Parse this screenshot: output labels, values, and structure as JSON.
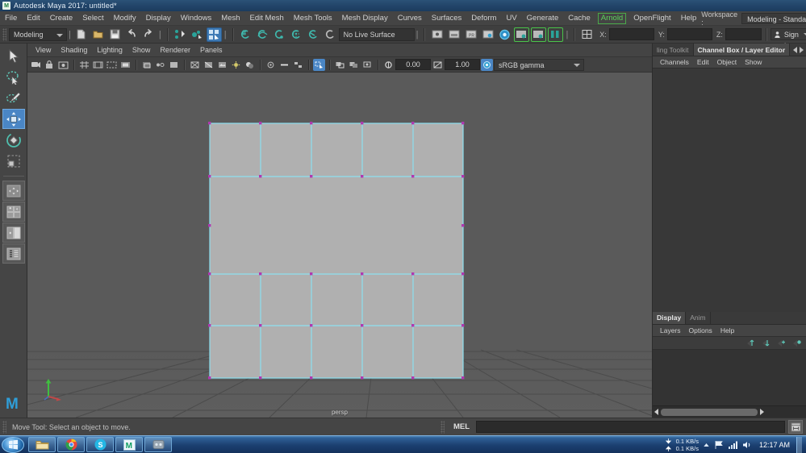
{
  "window": {
    "title": "Autodesk Maya 2017: untitled*",
    "app_icon": "maya-m-icon"
  },
  "menubar": {
    "items": [
      {
        "label": "File"
      },
      {
        "label": "Edit"
      },
      {
        "label": "Create"
      },
      {
        "label": "Select"
      },
      {
        "label": "Modify"
      },
      {
        "label": "Display"
      },
      {
        "label": "Windows"
      },
      {
        "label": "Mesh"
      },
      {
        "label": "Edit Mesh"
      },
      {
        "label": "Mesh Tools"
      },
      {
        "label": "Mesh Display"
      },
      {
        "label": "Curves"
      },
      {
        "label": "Surfaces"
      },
      {
        "label": "Deform"
      },
      {
        "label": "UV"
      },
      {
        "label": "Generate"
      },
      {
        "label": "Cache"
      },
      {
        "label": "Arnold",
        "highlighted": true
      },
      {
        "label": "OpenFlight"
      },
      {
        "label": "Help"
      }
    ],
    "workspace_label": "Workspace :",
    "workspace_value": "Modeling - Standard"
  },
  "statusline": {
    "menuset_value": "Modeling",
    "live_surface_value": "No Live Surface",
    "axis": {
      "x_label": "X:",
      "x_value": "",
      "y_label": "Y:",
      "y_value": "",
      "z_label": "Z:",
      "z_value": ""
    },
    "signin_label": "Sign In",
    "icons": [
      "new-scene-icon",
      "open-scene-icon",
      "save-scene-icon",
      "undo-icon",
      "redo-icon",
      "select-by-hierarchy-icon",
      "select-by-object-icon",
      "select-by-component-icon",
      "snap-to-grid-icon",
      "snap-to-curve-icon",
      "snap-to-point-icon",
      "snap-to-projected-center-icon",
      "snap-to-view-plane-icon",
      "make-live-icon",
      "show-outliner-icon",
      "show-hypergraph-icon",
      "show-hypershade-icon",
      "show-render-view-icon",
      "render-current-frame-icon",
      "ipr-render-icon",
      "render-settings-icon",
      "toggle-editors-icon",
      "input-output-icon"
    ],
    "right_icons": [
      "sidebar-attribute-icon",
      "sidebar-tool-icon",
      "sidebar-channel-icon",
      "sidebar-layer-icon",
      "sidebar-modeling-icon"
    ]
  },
  "toolbox": {
    "tools": [
      {
        "name": "select-tool",
        "icon": "arrow-cursor-icon",
        "active": false
      },
      {
        "name": "lasso-select-tool",
        "icon": "lasso-icon",
        "active": false
      },
      {
        "name": "paint-select-tool",
        "icon": "paintbrush-icon",
        "active": false
      },
      {
        "name": "move-tool",
        "icon": "move-arrows-icon",
        "active": true
      },
      {
        "name": "rotate-tool",
        "icon": "rotate-circle-icon",
        "active": false
      },
      {
        "name": "scale-tool",
        "icon": "scale-box-icon",
        "active": false
      }
    ],
    "layouts": [
      {
        "name": "single-pane-layout",
        "icon": "single-pane-icon"
      },
      {
        "name": "four-pane-layout",
        "icon": "four-pane-icon"
      },
      {
        "name": "two-pane-layout",
        "icon": "two-pane-icon"
      },
      {
        "name": "outliner-persp-layout",
        "icon": "outliner-persp-icon"
      }
    ],
    "logo": "M"
  },
  "viewport": {
    "menus": [
      {
        "label": "View"
      },
      {
        "label": "Shading"
      },
      {
        "label": "Lighting"
      },
      {
        "label": "Show"
      },
      {
        "label": "Renderer"
      },
      {
        "label": "Panels"
      }
    ],
    "toolbar": {
      "exposure_value": "0.00",
      "gamma_value": "1.00",
      "color_profile_value": "sRGB gamma",
      "icons": [
        "select-camera-icon",
        "lock-camera-icon",
        "camera-attributes-icon",
        "grid-toggle-icon",
        "film-gate-icon",
        "resolution-gate-icon",
        "gate-mask-icon",
        "xray-toggle-icon",
        "xray-joints-icon",
        "shaded-mode-icon",
        "wireframe-mode-icon",
        "wireframe-on-shaded-icon",
        "texture-mode-icon",
        "lighting-toggle-icon",
        "shadows-toggle-icon",
        "screen-space-ao-icon",
        "motion-blur-icon",
        "multisample-icon",
        "depth-peeling-icon",
        "isolate-select-icon",
        "image-plane-icon",
        "exposure-icon",
        "gamma-icon",
        "color-management-icon"
      ]
    },
    "camera_label": "persp",
    "axis_gizmo": {
      "y_axis": "Y",
      "x_axis": "X",
      "z_axis": "Z"
    },
    "colors": {
      "background": "#5a5a5a",
      "grid_line": "#4a4a4a",
      "mesh_fill": "#b0b0b0",
      "selected_edge": "#8ce0ef",
      "vertex": "#b038b0"
    },
    "mesh": {
      "name": "selected-polygon-mesh",
      "columns": 5,
      "rows": 4
    }
  },
  "channel_box": {
    "tabs": [
      {
        "label": "ling Toolkit",
        "active": false
      },
      {
        "label": "Channel Box / Layer Editor",
        "active": true
      }
    ],
    "menus": [
      {
        "label": "Channels"
      },
      {
        "label": "Edit"
      },
      {
        "label": "Object"
      },
      {
        "label": "Show"
      }
    ]
  },
  "layer_editor": {
    "tabs": [
      {
        "label": "Display",
        "active": true
      },
      {
        "label": "Anim",
        "active": false
      }
    ],
    "menus": [
      {
        "label": "Layers"
      },
      {
        "label": "Options"
      },
      {
        "label": "Help"
      }
    ],
    "icons": [
      "layer-move-up-icon",
      "layer-move-down-icon",
      "layer-new-icon",
      "layer-new-selected-icon"
    ]
  },
  "command_line": {
    "help_text": "Move Tool: Select an object to move.",
    "language_label": "MEL",
    "input_value": "",
    "render_icon": "script-editor-icon"
  },
  "taskbar": {
    "start_icon": "windows-start-orb-icon",
    "items": [
      {
        "name": "taskbar-explorer",
        "icon": "folder-icon"
      },
      {
        "name": "taskbar-chrome",
        "icon": "chrome-icon"
      },
      {
        "name": "taskbar-skype",
        "icon": "skype-icon"
      },
      {
        "name": "taskbar-maya",
        "icon": "maya-icon"
      },
      {
        "name": "taskbar-app",
        "icon": "app-icon"
      }
    ],
    "tray": {
      "download_speed": "0.1 KB/s",
      "upload_speed": "0.1 KB/s",
      "icons": [
        "show-hidden-icons-icon",
        "action-center-flag-icon",
        "network-signal-icon",
        "volume-icon"
      ],
      "clock": "12:17 AM"
    }
  }
}
